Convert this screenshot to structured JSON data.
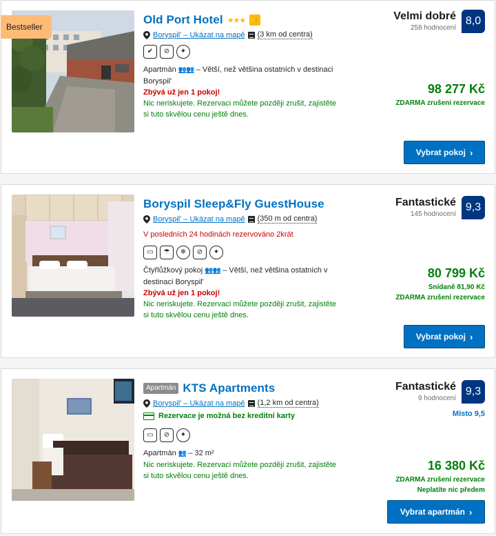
{
  "hotels": [
    {
      "name": "Old Port Hotel",
      "ribbon": "Bestseller",
      "stars": "★★★",
      "location_link": "Boryspil' – Ukázat na mapě",
      "distance": "(3 km od centra)",
      "room_type": "Apartmán",
      "room_desc": " – Větší, než většina ostatních v destinaci Boryspil'",
      "urgency": "Zbývá už jen 1 pokoj!",
      "free_cancel_note": "Nic neriskujete. Rezervaci můžete později zrušit, zajistěte si tuto skvělou cenu ještě dnes.",
      "review_word": "Velmi dobré",
      "review_count": "258 hodnocení",
      "score": "8,0",
      "price": "98 277 Kč",
      "price_note1": "ZDARMA zrušení rezervace",
      "cta": "Vybrat pokoj"
    },
    {
      "name": "Boryspil Sleep&Fly GuestHouse",
      "location_link": "Boryspil' – Ukázat na mapě",
      "distance": "(350 m od centra)",
      "booked_note": "V posledních 24 hodinách rezervováno 2krát",
      "room_type": "Čtyřlůžkový pokoj",
      "room_desc": " – Větší, než většina ostatních v destinaci Boryspil'",
      "urgency": "Zbývá už jen 1 pokoj!",
      "free_cancel_note": "Nic neriskujete. Rezervaci můžete později zrušit, zajistěte si tuto skvělou cenu ještě dnes.",
      "review_word": "Fantastické",
      "review_count": "145 hodnocení",
      "score": "9,3",
      "price": "80 799 Kč",
      "price_note1": "Snídaně 81,90 Kč",
      "price_note2": "ZDARMA zrušení rezervace",
      "cta": "Vybrat pokoj"
    },
    {
      "name": "KTS Apartments",
      "type_badge": "Apartmán",
      "location_link": "Boryspil' – Ukázat na mapě",
      "distance": "(1,2 km od centra)",
      "credit_note": "Rezervace je možná bez kreditní karty",
      "room_type": "Apartmán",
      "room_desc": " – 32 m²",
      "free_cancel_note": "Nic neriskujete. Rezervaci můžete později zrušit, zajistěte si tuto skvělou cenu ještě dnes.",
      "review_word": "Fantastické",
      "review_count": "9 hodnocení",
      "score": "9,3",
      "location_score": "Místo 9,5",
      "price": "16 380 Kč",
      "price_note1": "ZDARMA zrušení rezervace",
      "price_note2": "Neplatíte nic předem",
      "cta": "Vybrat apartmán"
    }
  ],
  "colors": {
    "brand_blue": "#0071c2",
    "score_bg": "#003580",
    "green": "#008009",
    "red": "#cc0000",
    "ribbon": "#febb76"
  },
  "icons": {
    "hotel1_amenities": [
      "check-circle-icon",
      "no-smoking-icon",
      "sparkle-icon"
    ],
    "hotel2_amenities": [
      "tv-icon",
      "umbrella-icon",
      "snowflake-icon",
      "no-smoking-icon",
      "sparkle-icon"
    ],
    "hotel3_amenities": [
      "tv-icon",
      "no-smoking-icon",
      "sparkle-icon"
    ]
  }
}
